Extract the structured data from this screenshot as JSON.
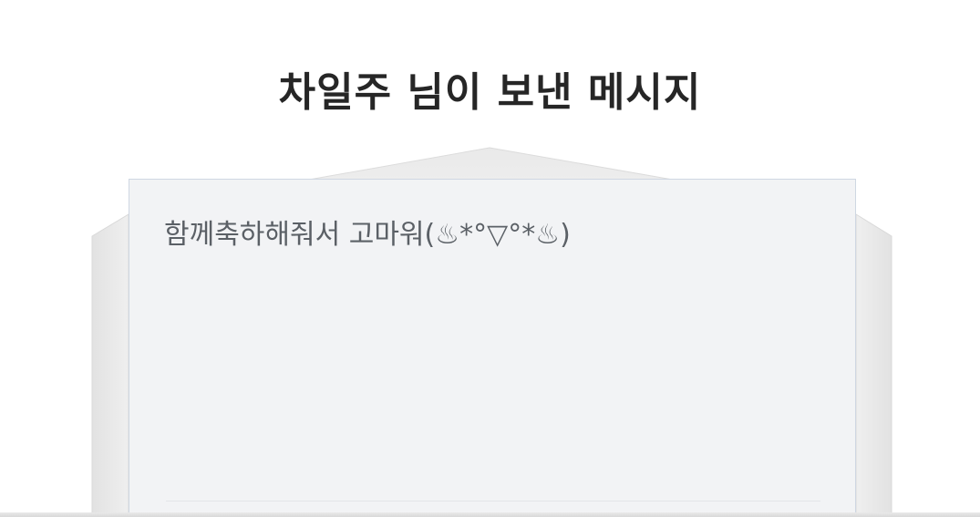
{
  "header": {
    "title": "차일주 님이 보낸 메시지"
  },
  "letter": {
    "message": "함께축하해줘서 고마워(♨*°▽°*♨)"
  },
  "colors": {
    "background": "#ffffff",
    "envelope": "#e6e6e6",
    "envelope_flap": "#efefef",
    "letter_background": "#f2f3f5",
    "letter_border": "#cfd7e2",
    "title_text": "#262626",
    "message_text": "#5b6066"
  }
}
